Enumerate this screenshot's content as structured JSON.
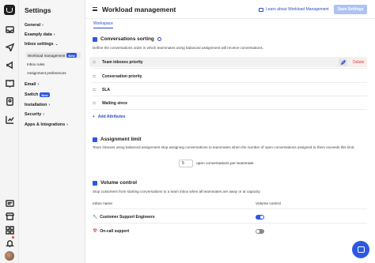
{
  "sidebar": {
    "title": "Settings",
    "items": [
      {
        "label": "General"
      },
      {
        "label": "Examply data"
      },
      {
        "label": "Inbox settings"
      },
      {
        "label": "Email"
      },
      {
        "label": "Switch",
        "badge": "New"
      },
      {
        "label": "Installation"
      },
      {
        "label": "Security"
      },
      {
        "label": "Apps & Integrations"
      }
    ],
    "sub_items": [
      {
        "label": "Workload management",
        "badge": "New"
      },
      {
        "label": "Inbox rules"
      },
      {
        "label": "Assignment preferences"
      }
    ]
  },
  "header": {
    "title": "Workload management",
    "learn_link": "Learn about Workload Management",
    "save_label": "Save Settings"
  },
  "tabs": [
    {
      "label": "Workspace"
    }
  ],
  "sorting": {
    "title": "Conversations sorting",
    "description": "Define the conversations order in which teammates using balanced assignment will receive conversations.",
    "rows": [
      {
        "label": "Team inboxes priority"
      },
      {
        "label": "Conversation priority"
      },
      {
        "label": "SLA"
      },
      {
        "label": "Waiting since"
      }
    ],
    "delete_label": "Delete",
    "add_label": "Add Attributes"
  },
  "limit": {
    "title": "Assignment limit",
    "description": "Team inboxes using balanced assignment stop assigning conversations to teammates when the number of open conversations assigned to them exceeds this limit.",
    "value": "5",
    "suffix": "open conversations per teammate"
  },
  "volume": {
    "title": "Volume control",
    "description": "Stop customers from starting conversations to a team inbox when all teammates are away or at capacity.",
    "col_inbox": "Inbox name",
    "col_volume": "Volume control",
    "rows": [
      {
        "emoji": "🔧",
        "name": "Customer Support Engineers",
        "enabled": true
      },
      {
        "emoji": "📅",
        "name": "On-call support",
        "enabled": false
      }
    ]
  },
  "colors": {
    "accent": "#2c59e0",
    "link": "#2c4cc8",
    "save_disabled": "#aec3f4",
    "danger": "#d6453d"
  }
}
